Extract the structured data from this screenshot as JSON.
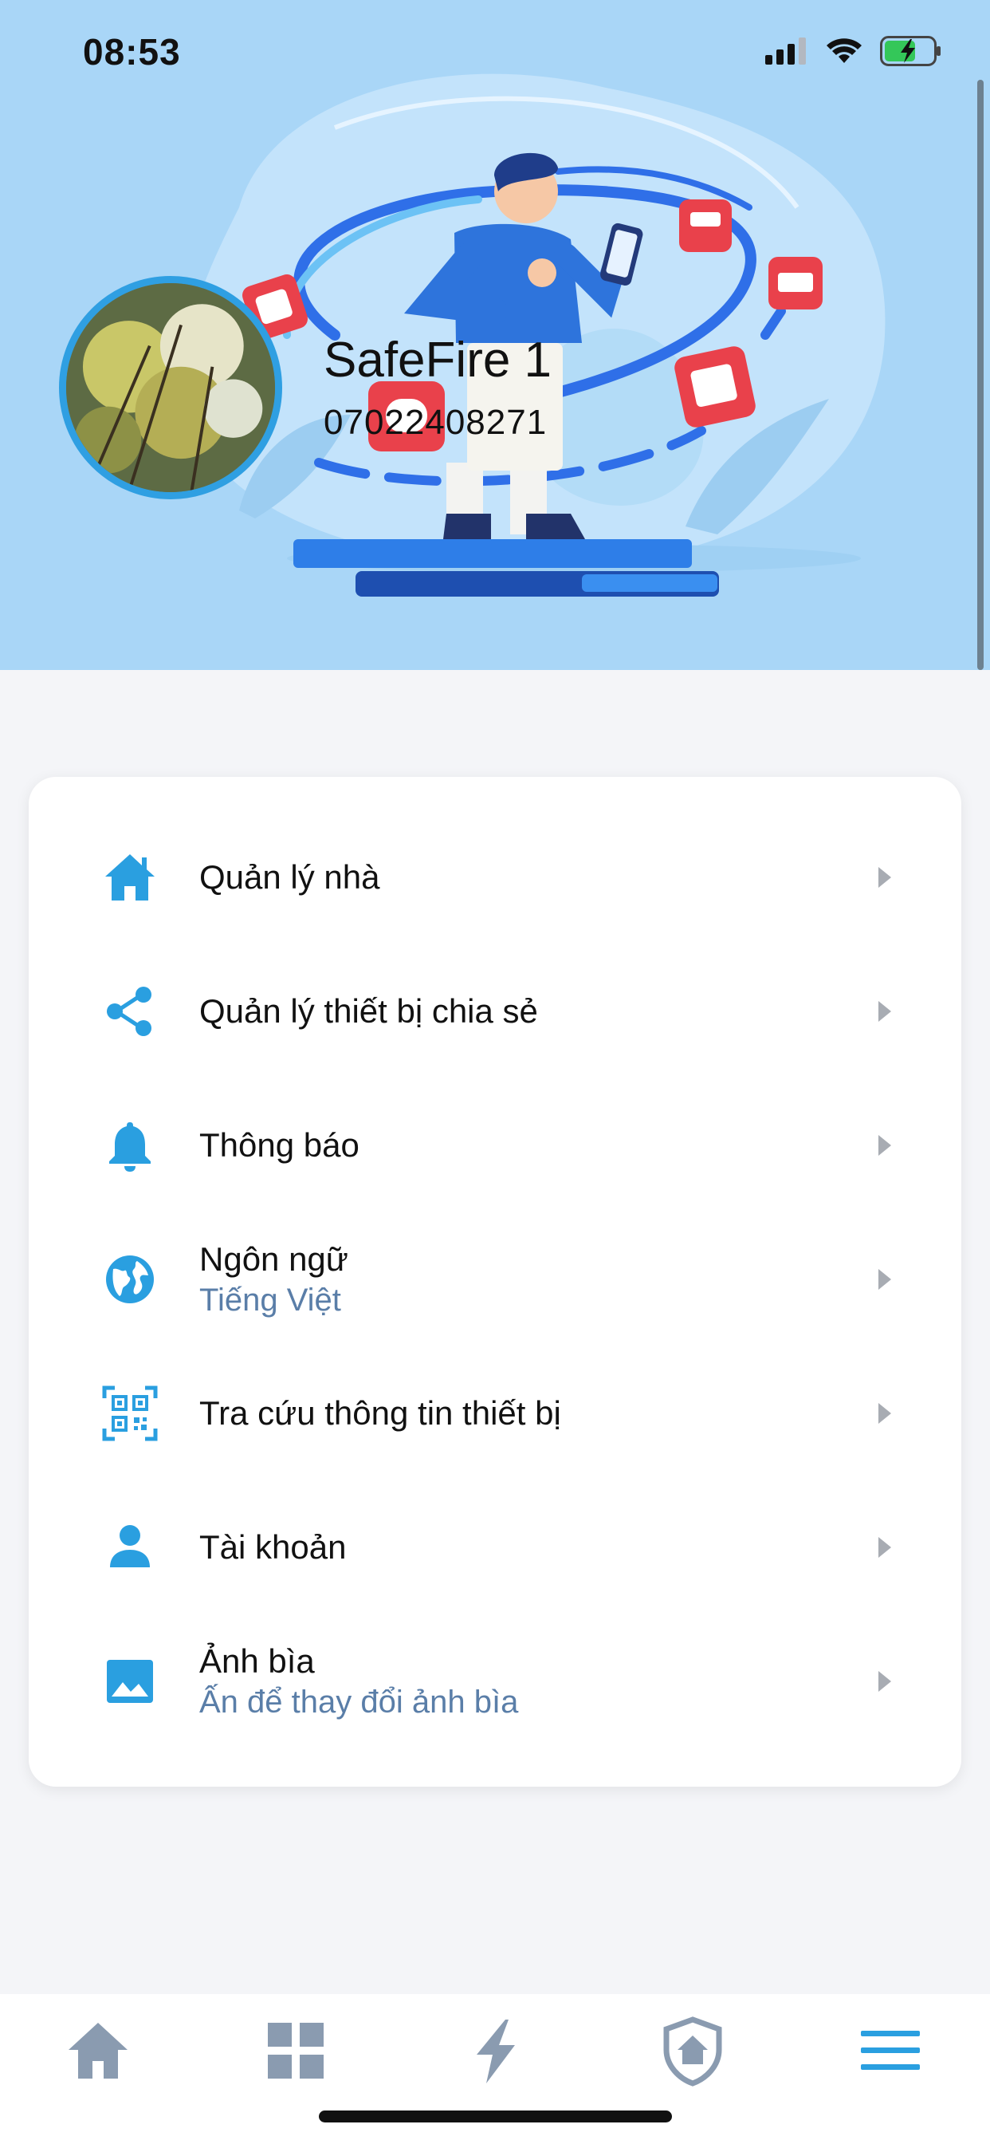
{
  "status_bar": {
    "time": "08:53",
    "icons": [
      "signal-icon",
      "wifi-icon",
      "battery-charging-icon"
    ]
  },
  "profile": {
    "name": "SafeFire 1",
    "phone": "07022408271"
  },
  "menu": {
    "items": [
      {
        "icon": "home-icon",
        "label": "Quản lý nhà",
        "sub": ""
      },
      {
        "icon": "share-icon",
        "label": "Quản lý thiết bị chia sẻ",
        "sub": ""
      },
      {
        "icon": "bell-icon",
        "label": "Thông báo",
        "sub": ""
      },
      {
        "icon": "globe-icon",
        "label": "Ngôn ngữ",
        "sub": "Tiếng Việt"
      },
      {
        "icon": "qr-code-icon",
        "label": "Tra cứu thông tin thiết bị",
        "sub": ""
      },
      {
        "icon": "person-icon",
        "label": "Tài khoản",
        "sub": ""
      },
      {
        "icon": "image-icon",
        "label": "Ảnh bìa",
        "sub": "Ấn để thay đổi ảnh bìa"
      }
    ]
  },
  "bottom_nav": {
    "items": [
      "home-icon",
      "grid-icon",
      "lightning-icon",
      "shield-home-icon",
      "menu-icon"
    ],
    "active": "menu-icon"
  },
  "colors": {
    "accent": "#2a9fe0",
    "header_bg": "#a9d6f7",
    "nav_inactive": "#8a9bb0",
    "subtitle": "#5a7ea8"
  }
}
